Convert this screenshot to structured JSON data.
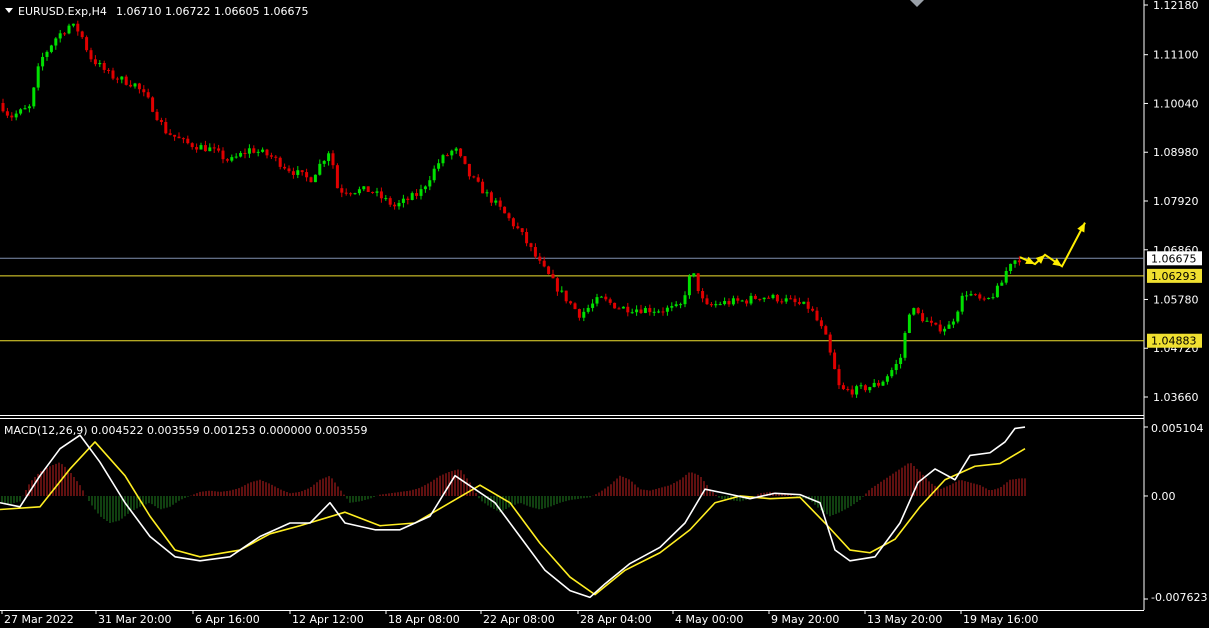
{
  "header": {
    "symbol": "EURUSD.Exp,H4",
    "ohlc": "1.06710 1.06722 1.06605 1.06675"
  },
  "price_axis": {
    "ticks": [
      "1.12180",
      "1.11100",
      "1.10040",
      "1.08980",
      "1.07920",
      "1.06860",
      "1.05780",
      "1.04720",
      "1.03660"
    ],
    "current_label": "1.06675",
    "level_labels": [
      "1.06293",
      "1.04883"
    ]
  },
  "macd": {
    "label": "MACD(12,26,9) 0.004522 0.003559 0.001253 0.000000 0.003559",
    "ticks": [
      "0.005104",
      "0.00",
      "-0.007623"
    ]
  },
  "time_axis": {
    "labels": [
      "27 Mar 2022",
      "31 Mar 20:00",
      "6 Apr 16:00",
      "12 Apr 12:00",
      "18 Apr 08:00",
      "22 Apr 08:00",
      "28 Apr 04:00",
      "4 May 00:00",
      "9 May 20:00",
      "13 May 20:00",
      "19 May 16:00"
    ]
  },
  "colors": {
    "background": "#000000",
    "bull_candle": "#00e000",
    "bear_candle": "#e00000",
    "level_line": "#f0e030",
    "current_price_line": "#8090b0",
    "macd_main": "#ffffff",
    "macd_signal": "#ffee22",
    "hist_positive": "#c02020",
    "hist_negative": "#208020",
    "projection_arrow": "#ffee00"
  },
  "chart_data": {
    "type": "candlestick",
    "symbol": "EURUSD",
    "timeframe": "H4",
    "x_range": [
      "27 Mar 2022",
      "19 May 16:00"
    ],
    "y_range": [
      1.0343,
      1.1228
    ],
    "current_price": 1.06675,
    "horizontal_levels": [
      1.06293,
      1.04883
    ],
    "price_path": [
      [
        0,
        1.1005
      ],
      [
        10,
        1.0975
      ],
      [
        30,
        1.0995
      ],
      [
        40,
        1.1095
      ],
      [
        55,
        1.1145
      ],
      [
        70,
        1.1175
      ],
      [
        80,
        1.116
      ],
      [
        90,
        1.1105
      ],
      [
        110,
        1.1065
      ],
      [
        135,
        1.1045
      ],
      [
        150,
        1.1005
      ],
      [
        165,
        1.0945
      ],
      [
        185,
        1.0918
      ],
      [
        210,
        1.0905
      ],
      [
        230,
        1.0878
      ],
      [
        250,
        1.0905
      ],
      [
        270,
        1.089
      ],
      [
        290,
        1.086
      ],
      [
        310,
        1.0838
      ],
      [
        330,
        1.0905
      ],
      [
        338,
        1.0815
      ],
      [
        350,
        1.0815
      ],
      [
        370,
        1.0815
      ],
      [
        395,
        1.078
      ],
      [
        420,
        1.081
      ],
      [
        440,
        1.088
      ],
      [
        455,
        1.0905
      ],
      [
        470,
        1.0845
      ],
      [
        500,
        1.0775
      ],
      [
        520,
        1.0725
      ],
      [
        540,
        1.0655
      ],
      [
        560,
        1.0595
      ],
      [
        580,
        1.0545
      ],
      [
        600,
        1.058
      ],
      [
        620,
        1.056
      ],
      [
        660,
        1.0555
      ],
      [
        680,
        1.056
      ],
      [
        692,
        1.064
      ],
      [
        705,
        1.056
      ],
      [
        720,
        1.057
      ],
      [
        745,
        1.0575
      ],
      [
        760,
        1.0585
      ],
      [
        780,
        1.058
      ],
      [
        810,
        1.056
      ],
      [
        825,
        1.05
      ],
      [
        840,
        1.038
      ],
      [
        855,
        1.038
      ],
      [
        880,
        1.0395
      ],
      [
        900,
        1.0445
      ],
      [
        910,
        1.056
      ],
      [
        935,
        1.0515
      ],
      [
        950,
        1.052
      ],
      [
        965,
        1.0595
      ],
      [
        985,
        1.057
      ],
      [
        1000,
        1.0605
      ],
      [
        1010,
        1.066
      ],
      [
        1020,
        1.0668
      ]
    ],
    "projection": [
      [
        1020,
        1.067
      ],
      [
        1035,
        1.0655
      ],
      [
        1045,
        1.0675
      ],
      [
        1062,
        1.065
      ],
      [
        1085,
        1.0745
      ]
    ],
    "macd": {
      "params": [
        12,
        26,
        9
      ],
      "values": [
        0.004522,
        0.003559,
        0.001253,
        0.0,
        0.003559
      ],
      "y_range": [
        -0.007623,
        0.005104
      ],
      "main": [
        [
          0,
          -0.0005
        ],
        [
          20,
          -0.0008
        ],
        [
          40,
          0.0015
        ],
        [
          60,
          0.0035
        ],
        [
          80,
          0.0045
        ],
        [
          100,
          0.0025
        ],
        [
          125,
          -0.0005
        ],
        [
          150,
          -0.003
        ],
        [
          175,
          -0.0045
        ],
        [
          200,
          -0.0048
        ],
        [
          230,
          -0.0045
        ],
        [
          260,
          -0.003
        ],
        [
          290,
          -0.002
        ],
        [
          310,
          -0.002
        ],
        [
          330,
          -0.0005
        ],
        [
          345,
          -0.002
        ],
        [
          375,
          -0.0025
        ],
        [
          400,
          -0.0025
        ],
        [
          430,
          -0.0015
        ],
        [
          455,
          0.0015
        ],
        [
          475,
          0.0005
        ],
        [
          495,
          -0.0005
        ],
        [
          520,
          -0.003
        ],
        [
          545,
          -0.0055
        ],
        [
          570,
          -0.007
        ],
        [
          590,
          -0.0075
        ],
        [
          605,
          -0.0065
        ],
        [
          630,
          -0.005
        ],
        [
          660,
          -0.0038
        ],
        [
          685,
          -0.002
        ],
        [
          705,
          0.0005
        ],
        [
          725,
          0.0002
        ],
        [
          750,
          -0.0002
        ],
        [
          775,
          0.0002
        ],
        [
          800,
          0.0001
        ],
        [
          820,
          -0.0005
        ],
        [
          835,
          -0.004
        ],
        [
          850,
          -0.0048
        ],
        [
          875,
          -0.0045
        ],
        [
          900,
          -0.002
        ],
        [
          918,
          0.001
        ],
        [
          935,
          0.002
        ],
        [
          955,
          0.0012
        ],
        [
          970,
          0.003
        ],
        [
          990,
          0.0032
        ],
        [
          1005,
          0.004
        ],
        [
          1015,
          0.005
        ],
        [
          1025,
          0.0051
        ]
      ],
      "signal": [
        [
          0,
          -0.001
        ],
        [
          40,
          -0.0008
        ],
        [
          70,
          0.002
        ],
        [
          95,
          0.004
        ],
        [
          125,
          0.0015
        ],
        [
          150,
          -0.0015
        ],
        [
          175,
          -0.004
        ],
        [
          200,
          -0.0045
        ],
        [
          240,
          -0.004
        ],
        [
          270,
          -0.0028
        ],
        [
          300,
          -0.0022
        ],
        [
          345,
          -0.0012
        ],
        [
          380,
          -0.0022
        ],
        [
          415,
          -0.002
        ],
        [
          450,
          -0.0005
        ],
        [
          480,
          0.0008
        ],
        [
          510,
          -0.0005
        ],
        [
          540,
          -0.0035
        ],
        [
          570,
          -0.006
        ],
        [
          595,
          -0.0073
        ],
        [
          625,
          -0.0055
        ],
        [
          660,
          -0.0042
        ],
        [
          690,
          -0.0025
        ],
        [
          715,
          -0.0005
        ],
        [
          740,
          0.0
        ],
        [
          770,
          -0.0002
        ],
        [
          800,
          -0.0001
        ],
        [
          825,
          -0.002
        ],
        [
          850,
          -0.004
        ],
        [
          870,
          -0.0042
        ],
        [
          895,
          -0.0032
        ],
        [
          920,
          -0.0008
        ],
        [
          945,
          0.0012
        ],
        [
          975,
          0.0022
        ],
        [
          1000,
          0.0024
        ],
        [
          1025,
          0.0035
        ]
      ],
      "histogram": [
        [
          0,
          -0.0005
        ],
        [
          10,
          -0.0006
        ],
        [
          20,
          -0.0004
        ],
        [
          30,
          0.001
        ],
        [
          40,
          0.0018
        ],
        [
          50,
          0.0022
        ],
        [
          60,
          0.0025
        ],
        [
          70,
          0.0018
        ],
        [
          80,
          0.0008
        ],
        [
          90,
          -0.0005
        ],
        [
          100,
          -0.0015
        ],
        [
          110,
          -0.002
        ],
        [
          120,
          -0.0018
        ],
        [
          130,
          -0.0012
        ],
        [
          140,
          -0.0008
        ],
        [
          150,
          -0.0005
        ],
        [
          160,
          -0.001
        ],
        [
          170,
          -0.0008
        ],
        [
          180,
          -0.0003
        ],
        [
          190,
          0.0
        ],
        [
          200,
          0.0003
        ],
        [
          210,
          0.0004
        ],
        [
          220,
          0.0003
        ],
        [
          230,
          0.0004
        ],
        [
          240,
          0.0006
        ],
        [
          250,
          0.001
        ],
        [
          260,
          0.0012
        ],
        [
          270,
          0.0009
        ],
        [
          280,
          0.0005
        ],
        [
          290,
          0.0002
        ],
        [
          300,
          0.0003
        ],
        [
          310,
          0.0006
        ],
        [
          320,
          0.0012
        ],
        [
          330,
          0.0015
        ],
        [
          340,
          0.0005
        ],
        [
          350,
          -0.0005
        ],
        [
          360,
          -0.0004
        ],
        [
          370,
          -0.0002
        ],
        [
          380,
          0.0001
        ],
        [
          390,
          0.0002
        ],
        [
          400,
          0.0003
        ],
        [
          410,
          0.0004
        ],
        [
          420,
          0.0006
        ],
        [
          430,
          0.001
        ],
        [
          440,
          0.0015
        ],
        [
          450,
          0.0018
        ],
        [
          460,
          0.002
        ],
        [
          470,
          0.001
        ],
        [
          480,
          -0.0003
        ],
        [
          490,
          -0.0008
        ],
        [
          500,
          -0.0012
        ],
        [
          510,
          -0.0008
        ],
        [
          520,
          -0.0005
        ],
        [
          530,
          -0.0008
        ],
        [
          540,
          -0.001
        ],
        [
          550,
          -0.0008
        ],
        [
          560,
          -0.0005
        ],
        [
          570,
          -0.0003
        ],
        [
          580,
          -0.0002
        ],
        [
          590,
          -0.0001
        ],
        [
          600,
          0.0003
        ],
        [
          610,
          0.0008
        ],
        [
          620,
          0.0015
        ],
        [
          630,
          0.0012
        ],
        [
          640,
          0.0005
        ],
        [
          650,
          0.0004
        ],
        [
          660,
          0.0006
        ],
        [
          670,
          0.0008
        ],
        [
          680,
          0.0012
        ],
        [
          690,
          0.0018
        ],
        [
          700,
          0.0015
        ],
        [
          710,
          0.0005
        ],
        [
          720,
          -0.0002
        ],
        [
          730,
          -0.0003
        ],
        [
          740,
          -0.0004
        ],
        [
          750,
          -0.0002
        ],
        [
          760,
          0.0002
        ],
        [
          770,
          0.0003
        ],
        [
          780,
          0.0002
        ],
        [
          790,
          0.0001
        ],
        [
          800,
          -0.0001
        ],
        [
          810,
          -0.0003
        ],
        [
          820,
          -0.001
        ],
        [
          830,
          -0.0015
        ],
        [
          840,
          -0.0012
        ],
        [
          850,
          -0.0008
        ],
        [
          860,
          -0.0003
        ],
        [
          870,
          0.0005
        ],
        [
          880,
          0.001
        ],
        [
          890,
          0.0015
        ],
        [
          900,
          0.002
        ],
        [
          910,
          0.0025
        ],
        [
          920,
          0.0018
        ],
        [
          930,
          0.001
        ],
        [
          940,
          0.0005
        ],
        [
          950,
          0.0008
        ],
        [
          960,
          0.0012
        ],
        [
          970,
          0.001
        ],
        [
          980,
          0.0008
        ],
        [
          990,
          0.0004
        ],
        [
          1000,
          0.0006
        ],
        [
          1010,
          0.0012
        ],
        [
          1020,
          0.0013
        ]
      ]
    }
  }
}
